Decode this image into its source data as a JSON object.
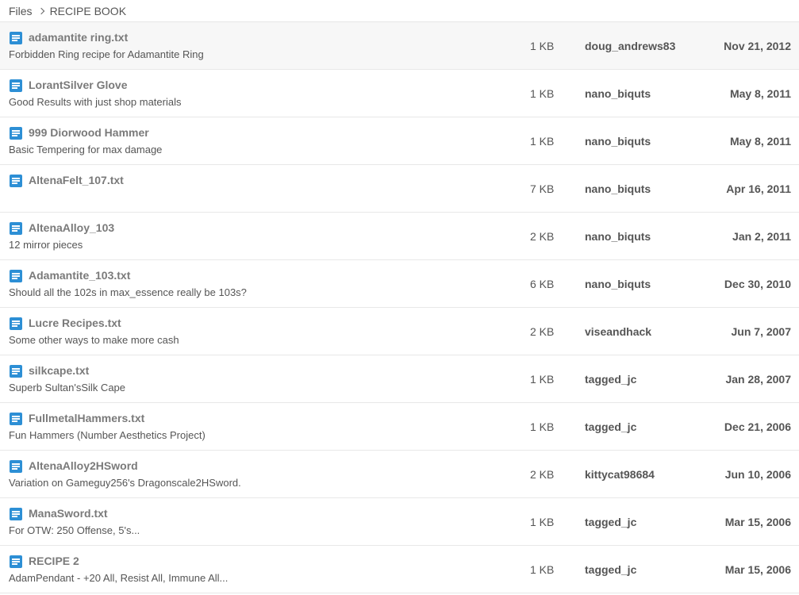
{
  "breadcrumb": {
    "root": "Files",
    "current": "RECIPE BOOK"
  },
  "icon": "text-document-icon",
  "accent_color": "#2d8fd5",
  "files": [
    {
      "name": "adamantite ring.txt",
      "description": "Forbidden Ring recipe for Adamantite Ring",
      "size": "1 KB",
      "user": "doug_andrews83",
      "date": "Nov 21, 2012"
    },
    {
      "name": "LorantSilver Glove",
      "description": "Good Results with just shop materials",
      "size": "1 KB",
      "user": "nano_biquts",
      "date": "May 8, 2011"
    },
    {
      "name": "999 Diorwood Hammer",
      "description": "Basic Tempering for max damage",
      "size": "1 KB",
      "user": "nano_biquts",
      "date": "May 8, 2011"
    },
    {
      "name": "AltenaFelt_107.txt",
      "description": "",
      "size": "7 KB",
      "user": "nano_biquts",
      "date": "Apr 16, 2011"
    },
    {
      "name": "AltenaAlloy_103",
      "description": "12 mirror pieces",
      "size": "2 KB",
      "user": "nano_biquts",
      "date": "Jan 2, 2011"
    },
    {
      "name": "Adamantite_103.txt",
      "description": "Should all the 102s in max_essence really be 103s?",
      "size": "6 KB",
      "user": "nano_biquts",
      "date": "Dec 30, 2010"
    },
    {
      "name": "Lucre Recipes.txt",
      "description": "Some other ways to make more cash",
      "size": "2 KB",
      "user": "viseandhack",
      "date": "Jun 7, 2007"
    },
    {
      "name": "silkcape.txt",
      "description": "Superb Sultan'sSilk Cape",
      "size": "1 KB",
      "user": "tagged_jc",
      "date": "Jan 28, 2007"
    },
    {
      "name": "FullmetalHammers.txt",
      "description": "Fun Hammers (Number Aesthetics Project)",
      "size": "1 KB",
      "user": "tagged_jc",
      "date": "Dec 21, 2006"
    },
    {
      "name": "AltenaAlloy2HSword",
      "description": "Variation on Gameguy256's Dragonscale2HSword.",
      "size": "2 KB",
      "user": "kittycat98684",
      "date": "Jun 10, 2006"
    },
    {
      "name": "ManaSword.txt",
      "description": "For OTW: 250 Offense, 5's...",
      "size": "1 KB",
      "user": "tagged_jc",
      "date": "Mar 15, 2006"
    },
    {
      "name": "RECIPE 2",
      "description": "AdamPendant - +20 All, Resist All, Immune All...",
      "size": "1 KB",
      "user": "tagged_jc",
      "date": "Mar 15, 2006"
    }
  ]
}
